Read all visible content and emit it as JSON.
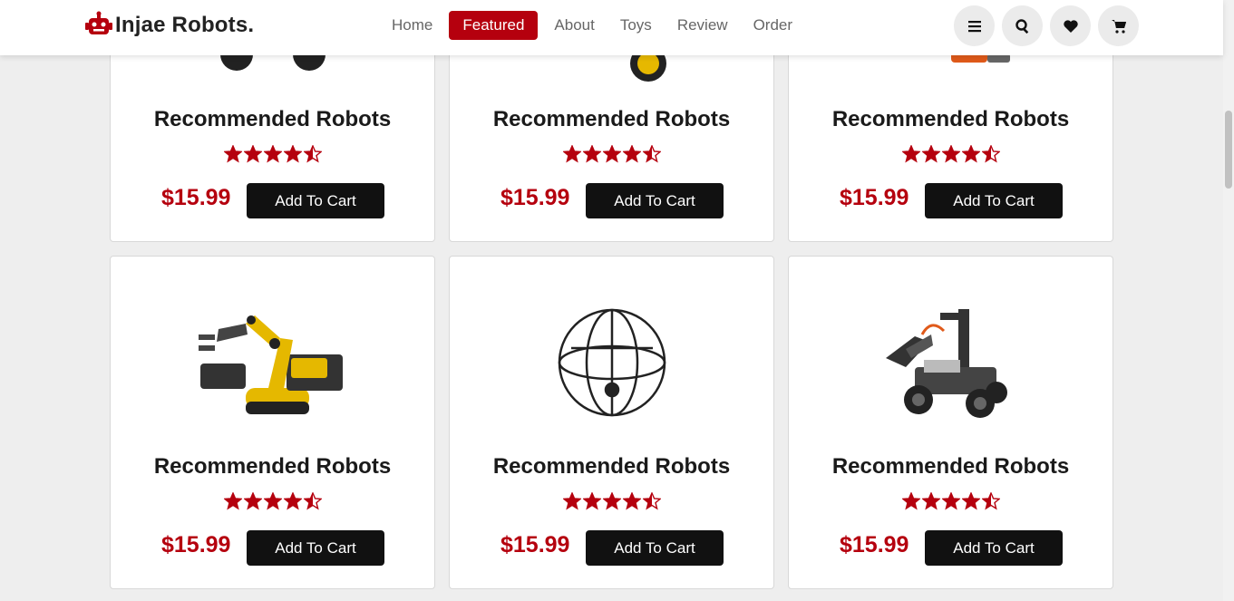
{
  "brand": {
    "name": "Injae Robots.",
    "icon": "robot-icon",
    "color": "#b5000e"
  },
  "nav": [
    {
      "label": "Home",
      "active": false
    },
    {
      "label": "Featured",
      "active": true
    },
    {
      "label": "About",
      "active": false
    },
    {
      "label": "Toys",
      "active": false
    },
    {
      "label": "Review",
      "active": false
    },
    {
      "label": "Order",
      "active": false
    }
  ],
  "header_icons": [
    "menu-icon",
    "search-icon",
    "heart-icon",
    "cart-icon"
  ],
  "products": [
    {
      "title": "Recommended Robots",
      "rating": 4.5,
      "price": "$15.99",
      "button": "Add To Cart",
      "image": "robot-car"
    },
    {
      "title": "Recommended Robots",
      "rating": 4.5,
      "price": "$15.99",
      "button": "Add To Cart",
      "image": "wheel-robot"
    },
    {
      "title": "Recommended Robots",
      "rating": 4.5,
      "price": "$15.99",
      "button": "Add To Cart",
      "image": "orange-robot"
    },
    {
      "title": "Recommended Robots",
      "rating": 4.5,
      "price": "$15.99",
      "button": "Add To Cart",
      "image": "robotic-arm"
    },
    {
      "title": "Recommended Robots",
      "rating": 4.5,
      "price": "$15.99",
      "button": "Add To Cart",
      "image": "sphere-drone"
    },
    {
      "title": "Recommended Robots",
      "rating": 4.5,
      "price": "$15.99",
      "button": "Add To Cart",
      "image": "gripper-rover"
    }
  ]
}
